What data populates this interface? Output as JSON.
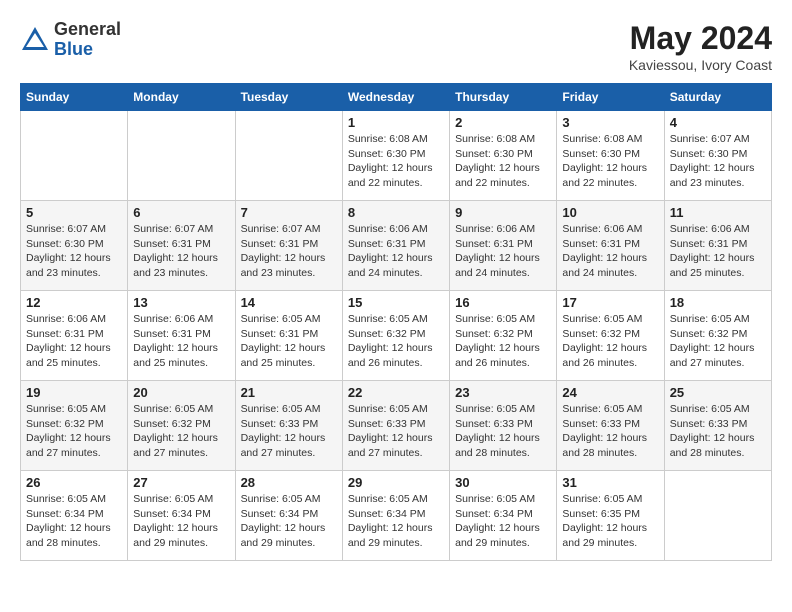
{
  "header": {
    "logo": {
      "general": "General",
      "blue": "Blue"
    },
    "month_year": "May 2024",
    "location": "Kaviessou, Ivory Coast"
  },
  "days_of_week": [
    "Sunday",
    "Monday",
    "Tuesday",
    "Wednesday",
    "Thursday",
    "Friday",
    "Saturday"
  ],
  "weeks": [
    [
      {
        "day": null
      },
      {
        "day": null
      },
      {
        "day": null
      },
      {
        "day": "1",
        "sunrise": "Sunrise: 6:08 AM",
        "sunset": "Sunset: 6:30 PM",
        "daylight": "Daylight: 12 hours and 22 minutes."
      },
      {
        "day": "2",
        "sunrise": "Sunrise: 6:08 AM",
        "sunset": "Sunset: 6:30 PM",
        "daylight": "Daylight: 12 hours and 22 minutes."
      },
      {
        "day": "3",
        "sunrise": "Sunrise: 6:08 AM",
        "sunset": "Sunset: 6:30 PM",
        "daylight": "Daylight: 12 hours and 22 minutes."
      },
      {
        "day": "4",
        "sunrise": "Sunrise: 6:07 AM",
        "sunset": "Sunset: 6:30 PM",
        "daylight": "Daylight: 12 hours and 23 minutes."
      }
    ],
    [
      {
        "day": "5",
        "sunrise": "Sunrise: 6:07 AM",
        "sunset": "Sunset: 6:30 PM",
        "daylight": "Daylight: 12 hours and 23 minutes."
      },
      {
        "day": "6",
        "sunrise": "Sunrise: 6:07 AM",
        "sunset": "Sunset: 6:31 PM",
        "daylight": "Daylight: 12 hours and 23 minutes."
      },
      {
        "day": "7",
        "sunrise": "Sunrise: 6:07 AM",
        "sunset": "Sunset: 6:31 PM",
        "daylight": "Daylight: 12 hours and 23 minutes."
      },
      {
        "day": "8",
        "sunrise": "Sunrise: 6:06 AM",
        "sunset": "Sunset: 6:31 PM",
        "daylight": "Daylight: 12 hours and 24 minutes."
      },
      {
        "day": "9",
        "sunrise": "Sunrise: 6:06 AM",
        "sunset": "Sunset: 6:31 PM",
        "daylight": "Daylight: 12 hours and 24 minutes."
      },
      {
        "day": "10",
        "sunrise": "Sunrise: 6:06 AM",
        "sunset": "Sunset: 6:31 PM",
        "daylight": "Daylight: 12 hours and 24 minutes."
      },
      {
        "day": "11",
        "sunrise": "Sunrise: 6:06 AM",
        "sunset": "Sunset: 6:31 PM",
        "daylight": "Daylight: 12 hours and 25 minutes."
      }
    ],
    [
      {
        "day": "12",
        "sunrise": "Sunrise: 6:06 AM",
        "sunset": "Sunset: 6:31 PM",
        "daylight": "Daylight: 12 hours and 25 minutes."
      },
      {
        "day": "13",
        "sunrise": "Sunrise: 6:06 AM",
        "sunset": "Sunset: 6:31 PM",
        "daylight": "Daylight: 12 hours and 25 minutes."
      },
      {
        "day": "14",
        "sunrise": "Sunrise: 6:05 AM",
        "sunset": "Sunset: 6:31 PM",
        "daylight": "Daylight: 12 hours and 25 minutes."
      },
      {
        "day": "15",
        "sunrise": "Sunrise: 6:05 AM",
        "sunset": "Sunset: 6:32 PM",
        "daylight": "Daylight: 12 hours and 26 minutes."
      },
      {
        "day": "16",
        "sunrise": "Sunrise: 6:05 AM",
        "sunset": "Sunset: 6:32 PM",
        "daylight": "Daylight: 12 hours and 26 minutes."
      },
      {
        "day": "17",
        "sunrise": "Sunrise: 6:05 AM",
        "sunset": "Sunset: 6:32 PM",
        "daylight": "Daylight: 12 hours and 26 minutes."
      },
      {
        "day": "18",
        "sunrise": "Sunrise: 6:05 AM",
        "sunset": "Sunset: 6:32 PM",
        "daylight": "Daylight: 12 hours and 27 minutes."
      }
    ],
    [
      {
        "day": "19",
        "sunrise": "Sunrise: 6:05 AM",
        "sunset": "Sunset: 6:32 PM",
        "daylight": "Daylight: 12 hours and 27 minutes."
      },
      {
        "day": "20",
        "sunrise": "Sunrise: 6:05 AM",
        "sunset": "Sunset: 6:32 PM",
        "daylight": "Daylight: 12 hours and 27 minutes."
      },
      {
        "day": "21",
        "sunrise": "Sunrise: 6:05 AM",
        "sunset": "Sunset: 6:33 PM",
        "daylight": "Daylight: 12 hours and 27 minutes."
      },
      {
        "day": "22",
        "sunrise": "Sunrise: 6:05 AM",
        "sunset": "Sunset: 6:33 PM",
        "daylight": "Daylight: 12 hours and 27 minutes."
      },
      {
        "day": "23",
        "sunrise": "Sunrise: 6:05 AM",
        "sunset": "Sunset: 6:33 PM",
        "daylight": "Daylight: 12 hours and 28 minutes."
      },
      {
        "day": "24",
        "sunrise": "Sunrise: 6:05 AM",
        "sunset": "Sunset: 6:33 PM",
        "daylight": "Daylight: 12 hours and 28 minutes."
      },
      {
        "day": "25",
        "sunrise": "Sunrise: 6:05 AM",
        "sunset": "Sunset: 6:33 PM",
        "daylight": "Daylight: 12 hours and 28 minutes."
      }
    ],
    [
      {
        "day": "26",
        "sunrise": "Sunrise: 6:05 AM",
        "sunset": "Sunset: 6:34 PM",
        "daylight": "Daylight: 12 hours and 28 minutes."
      },
      {
        "day": "27",
        "sunrise": "Sunrise: 6:05 AM",
        "sunset": "Sunset: 6:34 PM",
        "daylight": "Daylight: 12 hours and 29 minutes."
      },
      {
        "day": "28",
        "sunrise": "Sunrise: 6:05 AM",
        "sunset": "Sunset: 6:34 PM",
        "daylight": "Daylight: 12 hours and 29 minutes."
      },
      {
        "day": "29",
        "sunrise": "Sunrise: 6:05 AM",
        "sunset": "Sunset: 6:34 PM",
        "daylight": "Daylight: 12 hours and 29 minutes."
      },
      {
        "day": "30",
        "sunrise": "Sunrise: 6:05 AM",
        "sunset": "Sunset: 6:34 PM",
        "daylight": "Daylight: 12 hours and 29 minutes."
      },
      {
        "day": "31",
        "sunrise": "Sunrise: 6:05 AM",
        "sunset": "Sunset: 6:35 PM",
        "daylight": "Daylight: 12 hours and 29 minutes."
      },
      {
        "day": null
      }
    ]
  ]
}
